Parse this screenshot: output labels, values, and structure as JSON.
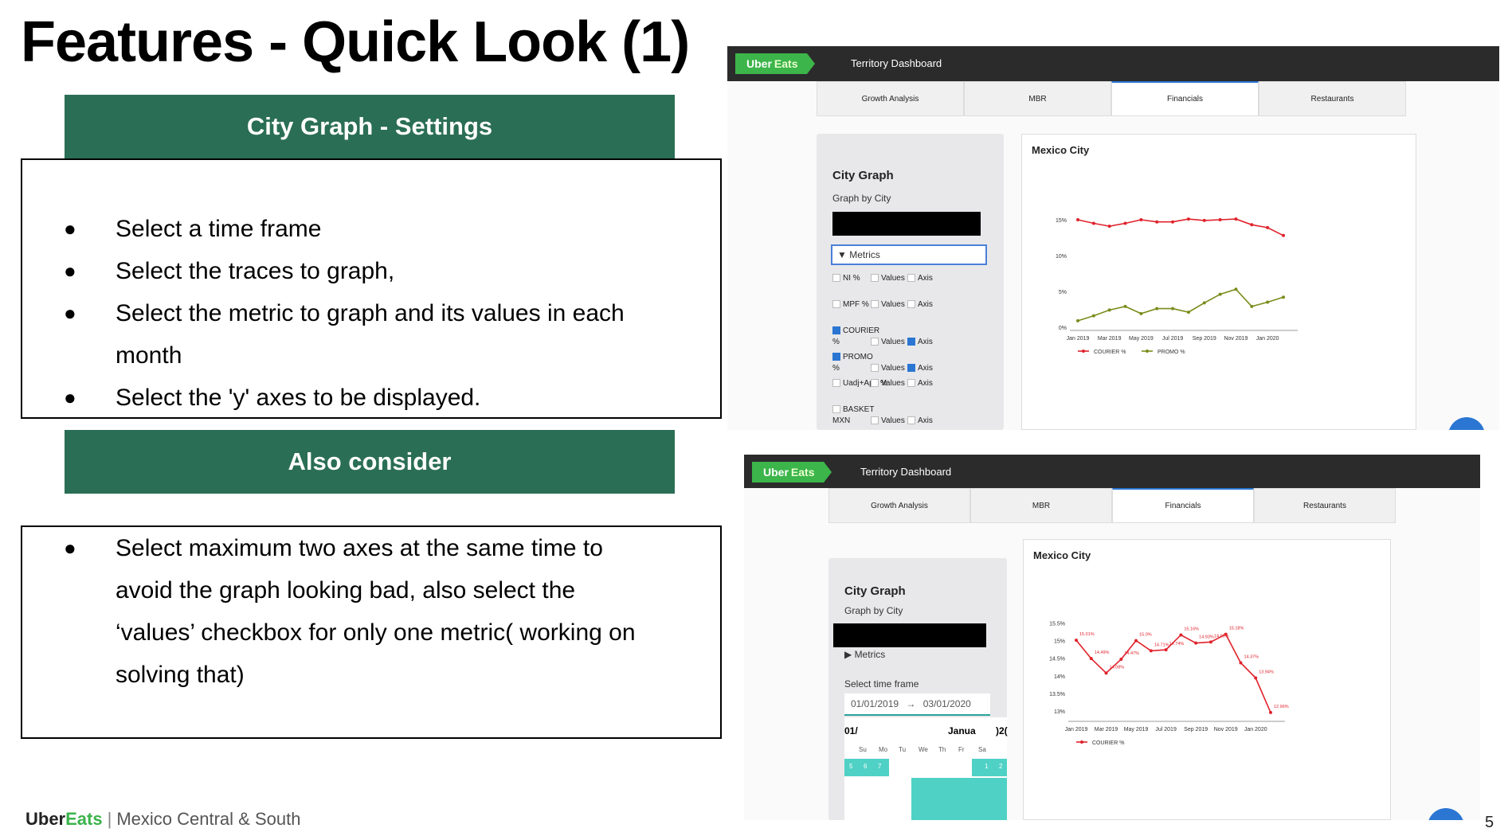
{
  "slide": {
    "title": "Features - Quick Look (1)",
    "page_number": "5",
    "footer": {
      "brand1": "Uber",
      "brand2": "Eats",
      "separator": "|",
      "region": "Mexico Central & South"
    }
  },
  "left": {
    "settings_banner": "City Graph - Settings",
    "settings_bullets": [
      "Select a time frame",
      "Select the traces to graph,",
      "Select the metric to graph and its values in each",
      "month",
      "Select the 'y' axes to be displayed."
    ],
    "consider_banner": "Also consider",
    "consider_lines": [
      "Select maximum two axes at the same time to",
      "avoid the graph looking bad, also select the",
      "‘values’ checkbox for only one metric( working on",
      "solving that)"
    ]
  },
  "screenshot1": {
    "logo1": "Uber",
    "logo2": "Eats",
    "app_title": "Territory Dashboard",
    "tabs": [
      "Growth Analysis",
      "MBR",
      "Financials",
      "Restaurants"
    ],
    "panel_title": "City Graph",
    "panel_sub": "Graph by City",
    "metrics_label": "▼ Metrics",
    "metric_rows": [
      {
        "name": "NI %",
        "name2": "",
        "on": false,
        "values": "Values",
        "values_on": false,
        "axis": "Axis",
        "axis_on": false
      },
      {
        "name": "MPF %",
        "name2": "",
        "on": false,
        "values": "Values",
        "values_on": false,
        "axis": "Axis",
        "axis_on": false
      },
      {
        "name": "COURIER",
        "name2": "%",
        "on": true,
        "values": "Values",
        "values_on": false,
        "axis": "Axis",
        "axis_on": true
      },
      {
        "name": "PROMO",
        "name2": "%",
        "on": true,
        "values": "Values",
        "values_on": false,
        "axis": "Axis",
        "axis_on": true
      },
      {
        "name": "",
        "name2": "Uadj+App %",
        "on": false,
        "values": "Values",
        "values_on": false,
        "axis": "Axis",
        "axis_on": false
      },
      {
        "name": "BASKET",
        "name2": "MXN",
        "on": false,
        "values": "Values",
        "values_on": false,
        "axis": "Axis",
        "axis_on": false
      }
    ],
    "chart_title": "Mexico City"
  },
  "screenshot2": {
    "logo1": "Uber",
    "logo2": "Eats",
    "app_title": "Territory Dashboard",
    "tabs": [
      "Growth Analysis",
      "MBR",
      "Financials",
      "Restaurants"
    ],
    "panel_title": "City Graph",
    "panel_sub": "Graph by City",
    "metrics_label": "▶ Metrics",
    "time_frame_label": "Select time frame",
    "date_start": "01/01/2019",
    "date_arrow": "→",
    "date_end": "03/01/2020",
    "cal_left": "01/",
    "cal_right": "Janua",
    "cal_right2": ")2(",
    "weekdays": [
      "Su",
      "Mo",
      "Tu",
      "We",
      "Th",
      "Fr",
      "Sa"
    ],
    "cal_days": [
      "5",
      "6",
      "7",
      "1",
      "2"
    ],
    "chart_title": "Mexico City"
  },
  "chart_data": [
    {
      "type": "line",
      "title": "Mexico City",
      "categories": [
        "Jan 2019",
        "Feb 2019",
        "Mar 2019",
        "Apr 2019",
        "May 2019",
        "Jun 2019",
        "Jul 2019",
        "Aug 2019",
        "Sep 2019",
        "Oct 2019",
        "Nov 2019",
        "Dec 2019",
        "Jan 2020",
        "Feb 2020"
      ],
      "x_tick_labels": [
        "Jan 2019",
        "Mar 2019",
        "May 2019",
        "Jul 2019",
        "Sep 2019",
        "Nov 2019",
        "Jan 2020"
      ],
      "yticks": [
        "15%",
        "10%",
        "5%",
        "0%"
      ],
      "ylim": [
        0,
        16
      ],
      "series": [
        {
          "name": "COURIER %",
          "color": "#e0222b",
          "values": [
            15.0,
            14.5,
            14.1,
            14.5,
            15.0,
            14.7,
            14.7,
            15.1,
            14.9,
            15.0,
            15.1,
            14.3,
            13.9,
            12.8
          ]
        },
        {
          "name": "PROMO %",
          "color": "#7b8c1a",
          "values": [
            0.9,
            1.6,
            2.4,
            2.9,
            1.9,
            2.6,
            2.6,
            2.1,
            3.4,
            4.6,
            5.3,
            2.9,
            3.5,
            4.2
          ]
        }
      ],
      "legend": "bottom"
    },
    {
      "type": "line",
      "title": "Mexico City",
      "categories": [
        "Jan 2019",
        "Feb 2019",
        "Mar 2019",
        "Apr 2019",
        "May 2019",
        "Jun 2019",
        "Jul 2019",
        "Aug 2019",
        "Sep 2019",
        "Oct 2019",
        "Nov 2019",
        "Dec 2019",
        "Jan 2020",
        "Feb 2020"
      ],
      "x_tick_labels": [
        "Jan 2019",
        "Mar 2019",
        "May 2019",
        "Jul 2019",
        "Sep 2019",
        "Nov 2019",
        "Jan 2020"
      ],
      "yticks": [
        "15.5%",
        "15%",
        "14.5%",
        "14%",
        "13.5%",
        "13%"
      ],
      "ylim": [
        12.8,
        15.6
      ],
      "series": [
        {
          "name": "COURIER %",
          "color": "#e0222b",
          "values": [
            15.01,
            14.49,
            14.08,
            14.47,
            15.0,
            14.71,
            14.74,
            15.16,
            14.93,
            14.96,
            15.18,
            14.37,
            13.94,
            12.96
          ],
          "labels": [
            "15.01%",
            "14.49%",
            "14.08%",
            "14.47%",
            "15.0%",
            "14.71%",
            "14.74%",
            "15.16%",
            "14.93%",
            "14.96%",
            "15.18%",
            "14.37%",
            "13.94%",
            "12.96%"
          ]
        }
      ],
      "legend": "bottom"
    }
  ]
}
